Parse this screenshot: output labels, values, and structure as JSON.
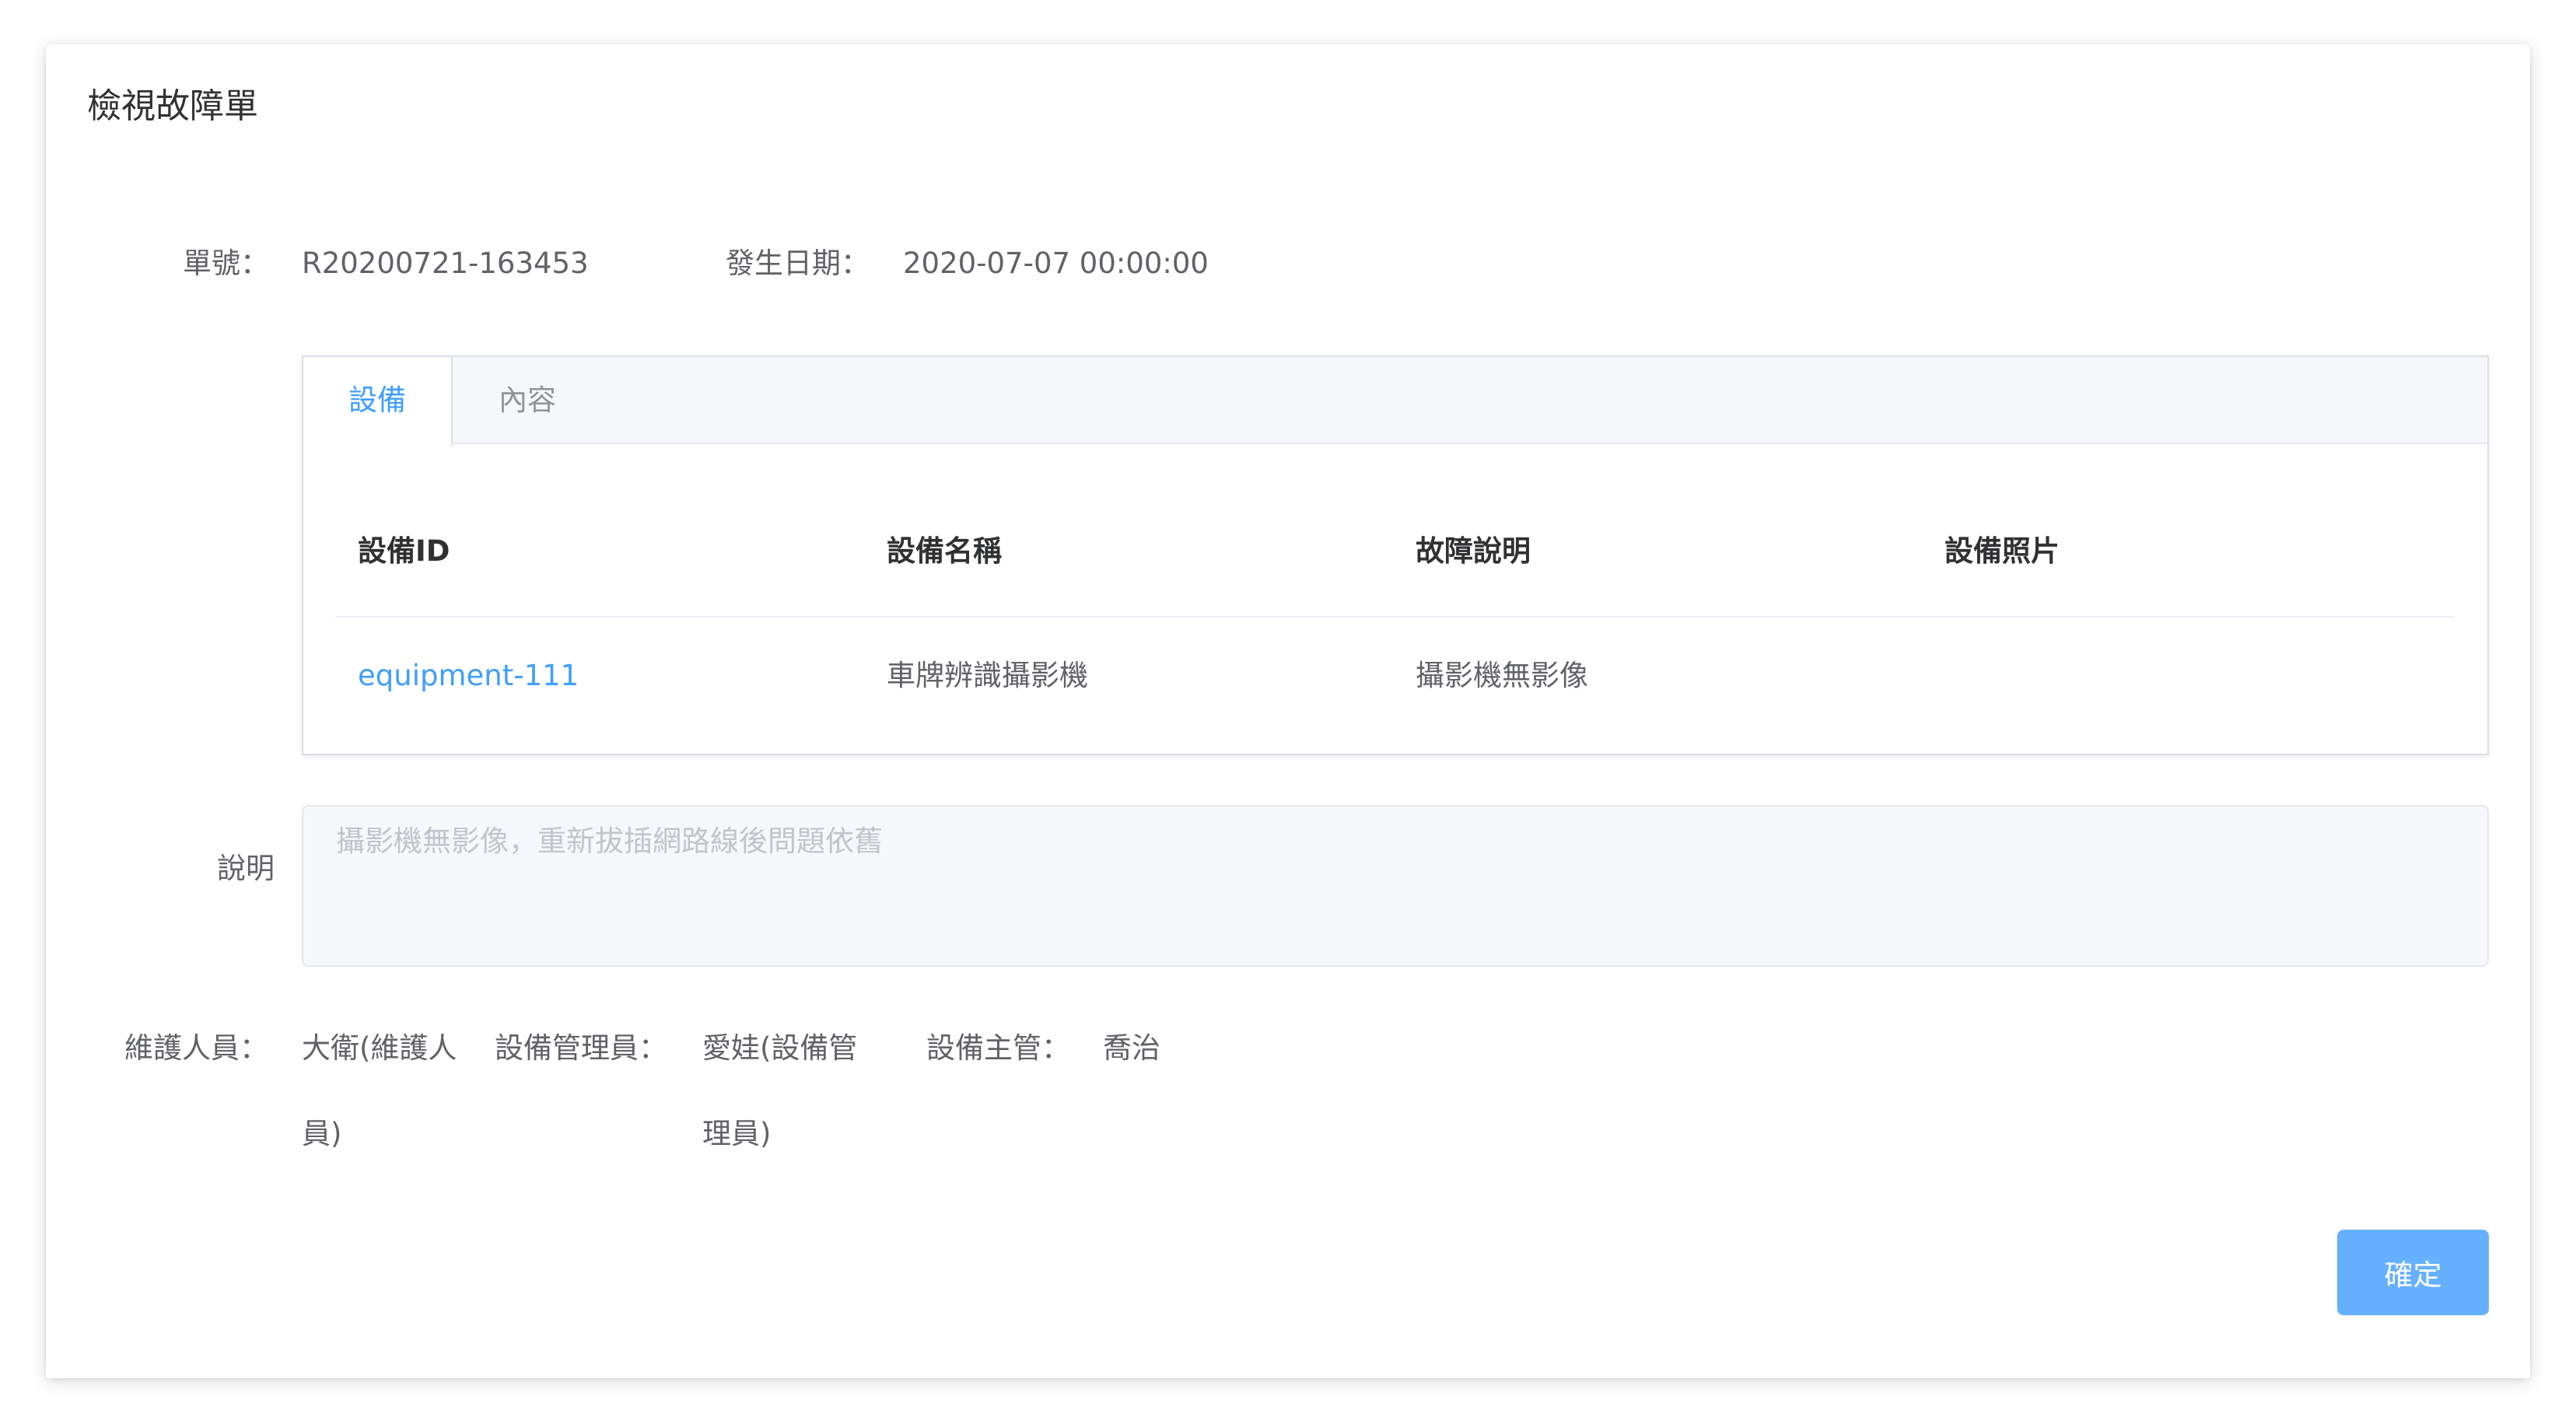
{
  "dialog": {
    "title": "檢視故障單"
  },
  "info": {
    "order_label": "單號：",
    "order_value": "R20200721-163453",
    "date_label": "發生日期：",
    "date_value": "2020-07-07 00:00:00"
  },
  "tabs": [
    {
      "label": "設備",
      "active": true
    },
    {
      "label": "內容",
      "active": false
    }
  ],
  "table": {
    "headers": [
      "設備ID",
      "設備名稱",
      "故障說明",
      "設備照片"
    ],
    "rows": [
      {
        "id": "equipment-111",
        "name": "車牌辨識攝影機",
        "fault": "攝影機無影像",
        "photo": ""
      }
    ]
  },
  "description": {
    "label": "說明",
    "placeholder": "攝影機無影像，重新拔插網路線後問題依舊"
  },
  "staff": {
    "maintainer_label": "維護人員：",
    "maintainer_value": "大衛(維護人員)",
    "manager_label": "設備管理員：",
    "manager_value": "愛娃(設備管理員)",
    "supervisor_label": "設備主管：",
    "supervisor_value": "喬治"
  },
  "actions": {
    "confirm_label": "確定"
  },
  "colors": {
    "primary": "#409eff",
    "button": "#66b1ff"
  }
}
